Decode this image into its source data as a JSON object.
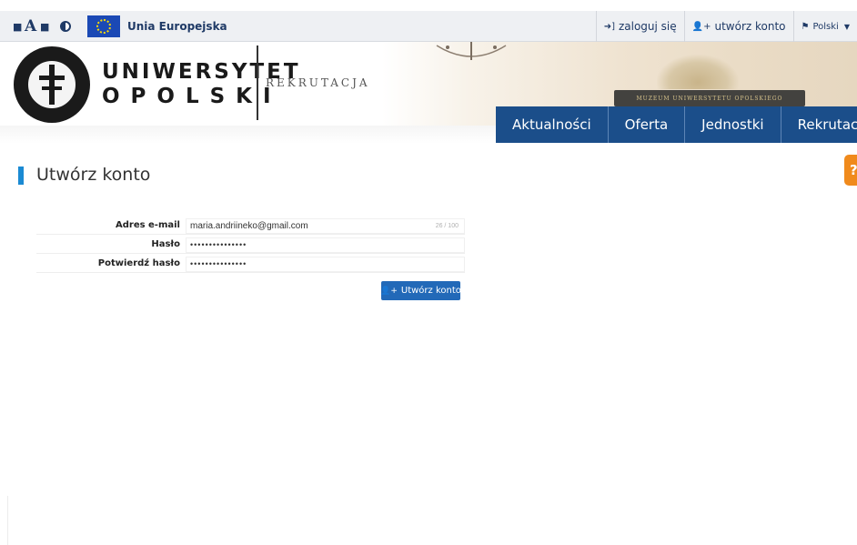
{
  "accessibility": {
    "decrease_font": "■",
    "font_label": "A",
    "increase_font": "■",
    "contrast_icon": "contrast-icon"
  },
  "eu": {
    "label": "Unia Europejska"
  },
  "top_links": {
    "login": {
      "icon": "sign-in-icon",
      "label": "zaloguj się"
    },
    "register": {
      "icon": "add-user-icon",
      "label": "utwórz konto"
    },
    "language": {
      "icon": "flag-icon",
      "label": "Polski",
      "chevron": "▼"
    }
  },
  "logo": {
    "line1": "UNIWERSYTET",
    "line2": "OPOLSKI",
    "subtitle": "REKRUTACJA"
  },
  "header_photo": {
    "plaque_text": "MUZEUM UNIWERSYTETU OPOLSKIEGO"
  },
  "nav": {
    "items": [
      {
        "label": "Aktualności"
      },
      {
        "label": "Oferta"
      },
      {
        "label": "Jednostki"
      },
      {
        "label": "Rekrutacja"
      }
    ]
  },
  "help": {
    "label": "?"
  },
  "page": {
    "title": "Utwórz konto"
  },
  "form": {
    "email": {
      "label": "Adres e-mail",
      "value": "maria.andriineko@gmail.com",
      "counter": "26 / 100"
    },
    "password": {
      "label": "Hasło",
      "value": "•••••••••••••••"
    },
    "confirm": {
      "label": "Potwierdź hasło",
      "value": "•••••••••••••••"
    },
    "submit": {
      "icon": "add-user-icon",
      "label": "Utwórz konto"
    }
  },
  "colors": {
    "nav_bg": "#1b4e8a",
    "accent": "#1b8ad3",
    "button": "#2269b8",
    "help": "#f08a1c"
  }
}
